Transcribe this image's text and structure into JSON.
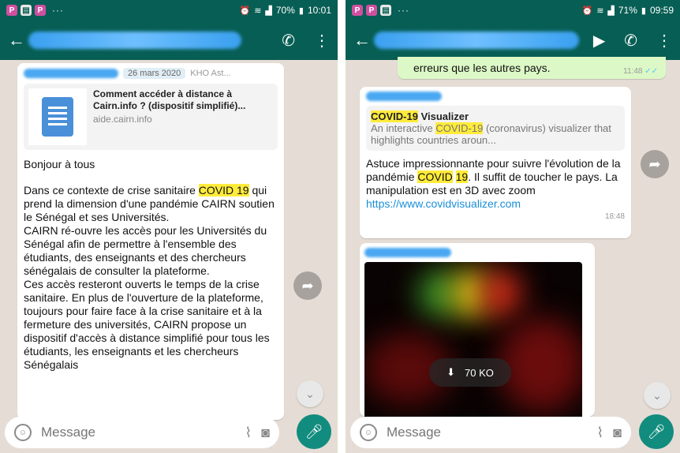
{
  "left": {
    "status": {
      "battery": "70%",
      "time": "10:01"
    },
    "date_badge": "26 mars 2020",
    "sender_suffix": "KHO Ast...",
    "preview": {
      "title": "Comment accéder à distance à Cairn.info ? (dispositif simplifié)...",
      "domain": "aide.cairn.info"
    },
    "message": {
      "greeting": "Bonjour à tous",
      "p1_before": "Dans ce contexte de crise sanitaire ",
      "p1_highlight": "COVID 19",
      "p1_after": " qui prend la dimension d'une pandémie CAIRN soutien le Sénégal et ses Universités.\nCAIRN ré-ouvre les accès pour les Universités du Sénégal afin de permettre à l'ensemble des étudiants, des enseignants et des chercheurs sénégalais de consulter la plateforme.\nCes accès resteront ouverts le temps de la crise sanitaire. En plus de l'ouverture de la plateforme, toujours pour faire face à la crise sanitaire et à la fermeture des universités, CAIRN propose un dispositif d'accès à distance simplifié pour tous les étudiants, les enseignants et les chercheurs Sénégalais"
    },
    "input_placeholder": "Message"
  },
  "right": {
    "status": {
      "battery": "71%",
      "time": "09:59"
    },
    "prev_message": {
      "text": "erreurs que les autres pays.",
      "time": "11:48"
    },
    "preview": {
      "title_hl": "COVID-19",
      "title_rest": " Visualizer",
      "desc_before": "An interactive ",
      "desc_hl": "COVID-19",
      "desc_after": " (coronavirus) visualizer that highlights countries aroun..."
    },
    "message": {
      "before": "Astuce impressionnante pour suivre l'évolution de la pandémie ",
      "hl1": "COVID",
      "hl2": "19",
      "after": ". Il suffit de toucher le pays. La manipulation est en 3D avec zoom",
      "link": "https://www.covidvisualizer.com",
      "time": "18:48"
    },
    "media_size": "70 KO",
    "input_placeholder": "Message"
  },
  "colors": {
    "header": "#075e54",
    "chat_bg": "#e5ddd5",
    "mic": "#128c7e",
    "highlight": "#ffeb3b",
    "link": "#1a8fd8"
  }
}
